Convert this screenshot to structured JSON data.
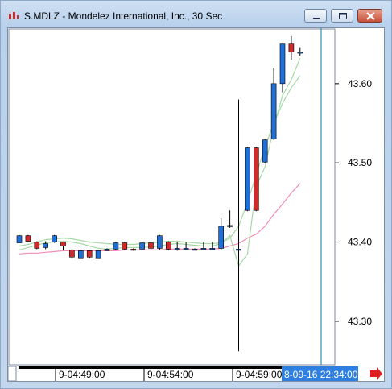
{
  "window": {
    "title": "S.MDLZ - Mondelez International, Inc., 30 Sec",
    "icon": "chart-app-icon",
    "buttons": [
      "minimize-icon",
      "maximize-icon",
      "close-icon"
    ]
  },
  "colors": {
    "up_candle": "#1e6fd8",
    "down_candle": "#d12a2a",
    "ma_fast": "#a8d8a8",
    "ma_slow": "#f08cb8",
    "cursor_line": "#2a8fb8",
    "time_highlight_bg": "#2f7fe0",
    "arrow": "#e02020"
  },
  "time_axis": {
    "labels": [
      "9-04:49:00",
      "9-04:54:00",
      "9-04:59:00"
    ],
    "cursor_time": "8-09-16 22:34:00"
  },
  "chart_data": {
    "type": "candlestick",
    "title": "",
    "xlabel": "",
    "ylabel": "",
    "ylim": [
      43.245,
      43.67
    ],
    "y_ticks": [
      "43.30",
      "43.40",
      "43.50",
      "43.60"
    ],
    "y_tick_values": [
      43.3,
      43.4,
      43.5,
      43.6
    ],
    "candles": [
      {
        "o": 43.399,
        "h": 43.409,
        "l": 43.399,
        "c": 43.408
      },
      {
        "o": 43.408,
        "h": 43.409,
        "l": 43.4,
        "c": 43.401
      },
      {
        "o": 43.4,
        "h": 43.401,
        "l": 43.391,
        "c": 43.392
      },
      {
        "o": 43.393,
        "h": 43.401,
        "l": 43.391,
        "c": 43.398
      },
      {
        "o": 43.4,
        "h": 43.409,
        "l": 43.399,
        "c": 43.408
      },
      {
        "o": 43.4,
        "h": 43.4,
        "l": 43.39,
        "c": 43.395
      },
      {
        "o": 43.39,
        "h": 43.392,
        "l": 43.38,
        "c": 43.381
      },
      {
        "o": 43.38,
        "h": 43.39,
        "l": 43.38,
        "c": 43.389
      },
      {
        "o": 43.389,
        "h": 43.39,
        "l": 43.38,
        "c": 43.381
      },
      {
        "o": 43.38,
        "h": 43.39,
        "l": 43.38,
        "c": 43.389
      },
      {
        "o": 43.389,
        "h": 43.392,
        "l": 43.389,
        "c": 43.391
      },
      {
        "o": 43.391,
        "h": 43.4,
        "l": 43.39,
        "c": 43.399
      },
      {
        "o": 43.399,
        "h": 43.4,
        "l": 43.39,
        "c": 43.391
      },
      {
        "o": 43.391,
        "h": 43.392,
        "l": 43.389,
        "c": 43.39
      },
      {
        "o": 43.391,
        "h": 43.4,
        "l": 43.39,
        "c": 43.399
      },
      {
        "o": 43.399,
        "h": 43.4,
        "l": 43.39,
        "c": 43.392
      },
      {
        "o": 43.392,
        "h": 43.409,
        "l": 43.39,
        "c": 43.408
      },
      {
        "o": 43.4,
        "h": 43.401,
        "l": 43.39,
        "c": 43.391
      },
      {
        "o": 43.391,
        "h": 43.4,
        "l": 43.389,
        "c": 43.392
      },
      {
        "o": 43.391,
        "h": 43.4,
        "l": 43.39,
        "c": 43.392
      },
      {
        "o": 43.391,
        "h": 43.392,
        "l": 43.39,
        "c": 43.391
      },
      {
        "o": 43.391,
        "h": 43.4,
        "l": 43.39,
        "c": 43.392
      },
      {
        "o": 43.391,
        "h": 43.4,
        "l": 43.39,
        "c": 43.392
      },
      {
        "o": 43.392,
        "h": 43.43,
        "l": 43.39,
        "c": 43.42
      },
      {
        "o": 43.42,
        "h": 43.44,
        "l": 43.418,
        "c": 43.421
      },
      {
        "o": 43.39,
        "h": 43.58,
        "l": 43.262,
        "c": 43.391
      },
      {
        "o": 43.44,
        "h": 43.52,
        "l": 43.439,
        "c": 43.519
      },
      {
        "o": 43.519,
        "h": 43.52,
        "l": 43.439,
        "c": 43.44
      },
      {
        "o": 43.501,
        "h": 43.53,
        "l": 43.5,
        "c": 43.529
      },
      {
        "o": 43.53,
        "h": 43.62,
        "l": 43.529,
        "c": 43.6
      },
      {
        "o": 43.6,
        "h": 43.65,
        "l": 43.589,
        "c": 43.65
      },
      {
        "o": 43.65,
        "h": 43.66,
        "l": 43.63,
        "c": 43.64
      },
      {
        "o": 43.64,
        "h": 43.646,
        "l": 43.635,
        "c": 43.64
      }
    ],
    "ma_fast": [
      43.39,
      43.393,
      43.396,
      43.399,
      43.4,
      43.401,
      43.4,
      43.398,
      43.395,
      43.392,
      43.391,
      43.392,
      43.393,
      43.393,
      43.393,
      43.394,
      43.395,
      43.397,
      43.398,
      43.397,
      43.396,
      43.395,
      43.395,
      43.398,
      43.408,
      43.37,
      43.385,
      43.47,
      43.495,
      43.545,
      43.585,
      43.605,
      43.632
    ],
    "ma_slow": [
      43.385,
      43.386,
      43.386,
      43.387,
      43.388,
      43.389,
      43.389,
      43.389,
      43.389,
      43.389,
      43.389,
      43.389,
      43.39,
      43.39,
      43.39,
      43.39,
      43.39,
      43.391,
      43.391,
      43.391,
      43.391,
      43.391,
      43.391,
      43.392,
      43.395,
      43.398,
      43.405,
      43.41,
      43.42,
      43.435,
      43.448,
      43.462,
      43.474
    ],
    "ma_mid": [
      43.395,
      43.397,
      43.4,
      43.403,
      43.404,
      43.405,
      43.404,
      43.402,
      43.4,
      43.399,
      43.398,
      43.397,
      43.397,
      43.397,
      43.398,
      43.399,
      43.4,
      43.401,
      43.401,
      43.4,
      43.399,
      43.398,
      43.398,
      43.399,
      43.405,
      43.42,
      43.45,
      43.485,
      43.52,
      43.55,
      43.575,
      43.595,
      43.61
    ]
  }
}
